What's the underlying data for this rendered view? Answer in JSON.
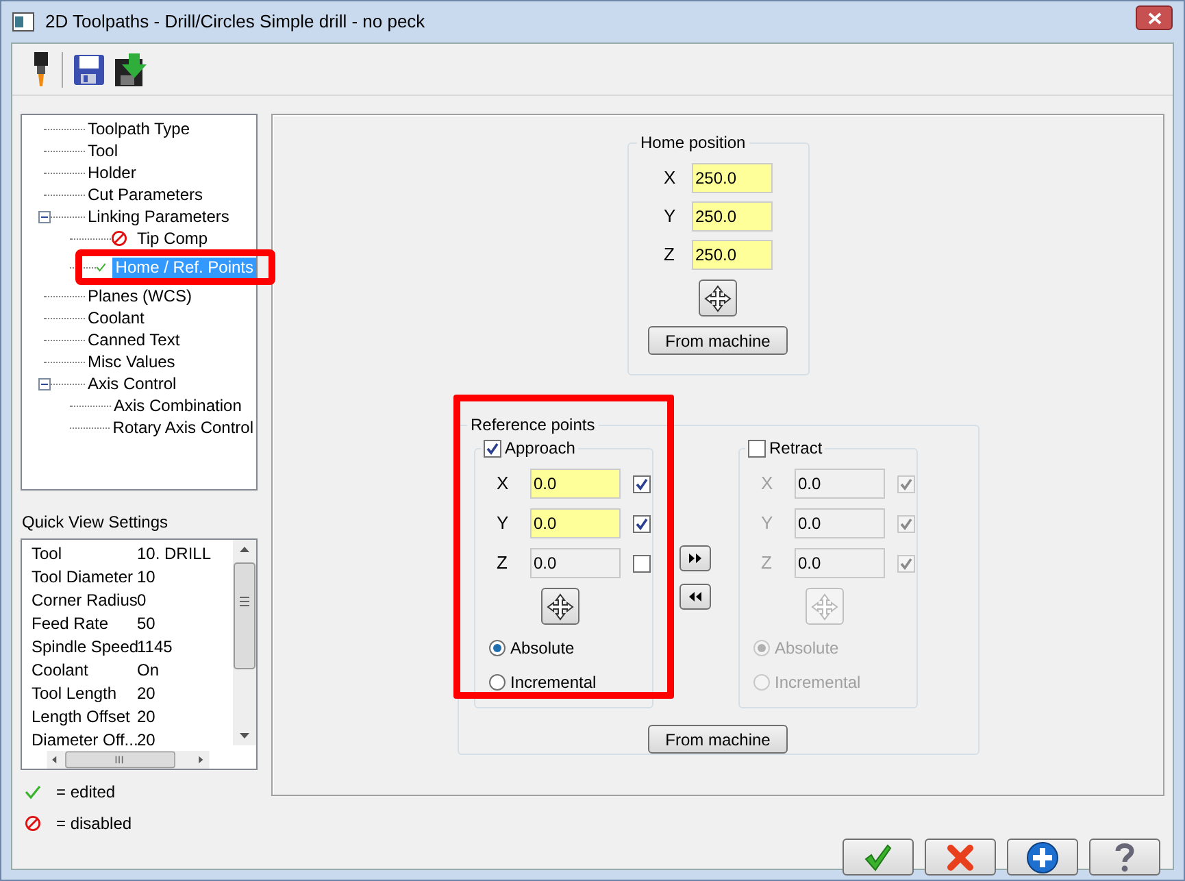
{
  "window": {
    "title": "2D Toolpaths - Drill/Circles Simple drill - no peck"
  },
  "tree": [
    {
      "label": "Toolpath Type",
      "selected": false
    },
    {
      "label": "Tool",
      "selected": false
    },
    {
      "label": "Holder",
      "selected": false
    },
    {
      "label": "Cut Parameters",
      "selected": false
    },
    {
      "label": "Linking Parameters",
      "selected": false,
      "expanded": true,
      "children": [
        {
          "label": "Tip Comp",
          "selected": false,
          "kind": "disabled"
        },
        {
          "label": "Home / Ref. Points",
          "selected": true,
          "kind": "edited"
        }
      ]
    },
    {
      "label": "Planes (WCS)",
      "selected": false
    },
    {
      "label": "Coolant",
      "selected": false
    },
    {
      "label": "Canned Text",
      "selected": false
    },
    {
      "label": "Misc Values",
      "selected": false
    },
    {
      "label": "Axis Control",
      "selected": false,
      "expanded": true,
      "children": [
        {
          "label": "Axis Combination",
          "selected": false
        },
        {
          "label": "Rotary Axis Control",
          "selected": false
        }
      ]
    }
  ],
  "quick_view": {
    "title": "Quick View Settings",
    "rows": [
      {
        "name": "Tool",
        "value": "10. DRILL"
      },
      {
        "name": "Tool Diameter",
        "value": "10"
      },
      {
        "name": "Corner Radius",
        "value": "0"
      },
      {
        "name": "Feed Rate",
        "value": "50"
      },
      {
        "name": "Spindle Speed",
        "value": "1145"
      },
      {
        "name": "Coolant",
        "value": "On"
      },
      {
        "name": "Tool Length",
        "value": "20"
      },
      {
        "name": "Length Offset",
        "value": "20"
      },
      {
        "name": "Diameter Off...",
        "value": "20"
      }
    ]
  },
  "legend": [
    {
      "kind": "edited",
      "label": "= edited"
    },
    {
      "kind": "disabled",
      "label": "= disabled"
    }
  ],
  "home_position": {
    "title": "Home position",
    "fields": [
      {
        "axis": "X",
        "value": "250.0"
      },
      {
        "axis": "Y",
        "value": "250.0"
      },
      {
        "axis": "Z",
        "value": "250.0"
      }
    ],
    "button": "From machine"
  },
  "reference_points": {
    "title": "Reference points",
    "approach": {
      "label": "Approach",
      "checked": true,
      "fields": [
        {
          "axis": "X",
          "value": "0.0",
          "enabled": true,
          "checked": true
        },
        {
          "axis": "Y",
          "value": "0.0",
          "enabled": true,
          "checked": true
        },
        {
          "axis": "Z",
          "value": "0.0",
          "enabled": false,
          "checked": false
        }
      ],
      "modes": [
        {
          "label": "Absolute",
          "selected": true
        },
        {
          "label": "Incremental",
          "selected": false
        }
      ]
    },
    "retract": {
      "label": "Retract",
      "checked": false,
      "fields": [
        {
          "axis": "X",
          "value": "0.0",
          "enabled": false,
          "checked": true
        },
        {
          "axis": "Y",
          "value": "0.0",
          "enabled": false,
          "checked": true
        },
        {
          "axis": "Z",
          "value": "0.0",
          "enabled": false,
          "checked": true
        }
      ],
      "modes": [
        {
          "label": "Absolute",
          "selected": true
        },
        {
          "label": "Incremental",
          "selected": false
        }
      ]
    },
    "button": "From machine"
  }
}
